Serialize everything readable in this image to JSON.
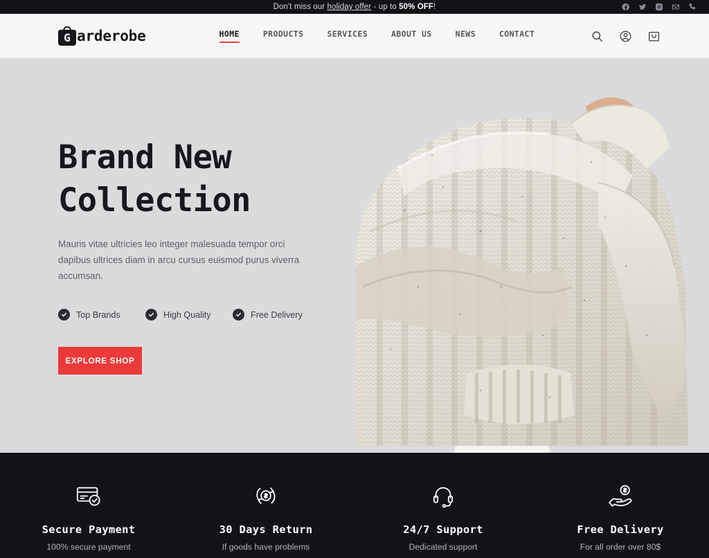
{
  "topbar": {
    "message_prefix": "Don't miss our ",
    "offer_link": "holiday offer",
    "message_middle": " - up to ",
    "discount": "50% OFF",
    "message_suffix": "!",
    "socials": [
      {
        "name": "facebook-icon",
        "label": "Facebook"
      },
      {
        "name": "twitter-icon",
        "label": "Twitter"
      },
      {
        "name": "instagram-icon",
        "label": "Instagram"
      },
      {
        "name": "email-icon",
        "label": "Email"
      },
      {
        "name": "phone-icon",
        "label": "Phone"
      }
    ]
  },
  "header": {
    "logo_mark": "G",
    "logo_text": "arderobe",
    "nav": [
      {
        "label": "HOME",
        "active": true
      },
      {
        "label": "PRODUCTS",
        "active": false
      },
      {
        "label": "SERVICES",
        "active": false
      },
      {
        "label": "ABOUT US",
        "active": false
      },
      {
        "label": "NEWS",
        "active": false
      },
      {
        "label": "CONTACT",
        "active": false
      }
    ],
    "actions": [
      {
        "name": "search-icon",
        "label": "Search"
      },
      {
        "name": "account-icon",
        "label": "Account"
      },
      {
        "name": "cart-icon",
        "label": "Cart"
      }
    ]
  },
  "hero": {
    "title": "Brand New\nCollection",
    "subtitle": "Mauris vitae ultricies leo integer malesuada tempor orci dapibus ultrices diam in arcu cursus euismod purus viverra accumsan.",
    "features": [
      {
        "label": "Top Brands"
      },
      {
        "label": "High Quality"
      },
      {
        "label": "Free Delivery"
      }
    ],
    "cta_label": "EXPLORE SHOP"
  },
  "feature_bar": {
    "items": [
      {
        "icon": "secure-card-icon",
        "title": "Secure Payment",
        "subtitle": "100% secure payment"
      },
      {
        "icon": "return-cycle-icon",
        "title": "30 Days Return",
        "subtitle": "If goods have problems"
      },
      {
        "icon": "headset-icon",
        "title": "24/7 Support",
        "subtitle": "Dedicated support"
      },
      {
        "icon": "hand-coin-icon",
        "title": "Free Delivery",
        "subtitle": "For all order over 80$"
      }
    ]
  },
  "colors": {
    "accent_red": "#ec3a3a",
    "dark": "#131218",
    "header_bg": "#f7f7f5",
    "hero_bg": "#dbdbdd"
  }
}
